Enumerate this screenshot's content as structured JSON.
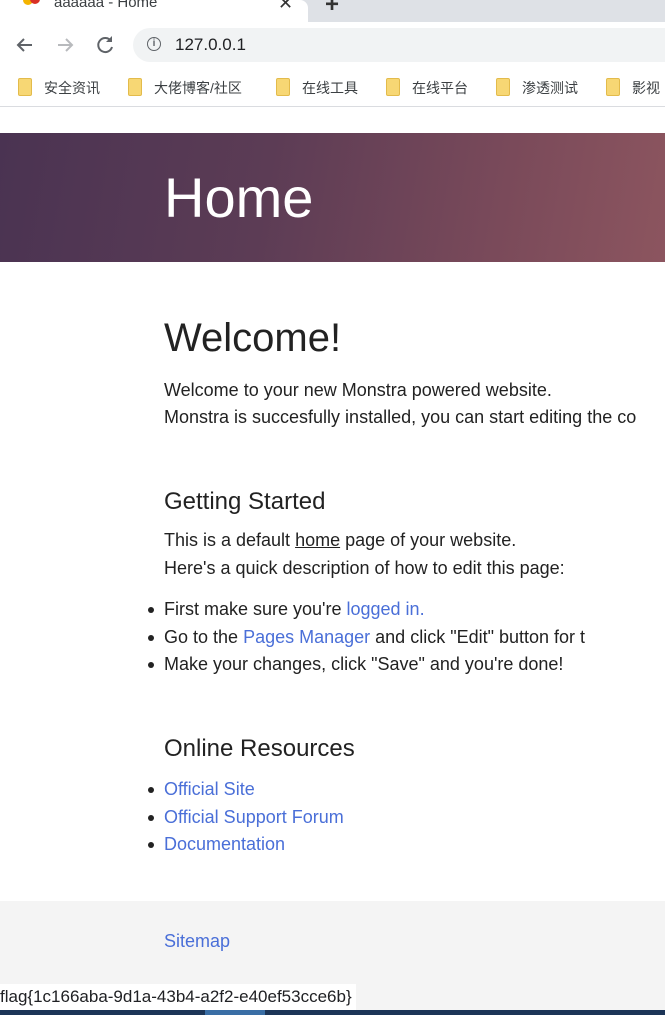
{
  "browser": {
    "tab_title": "aaaaaa - Home",
    "url": "127.0.0.1",
    "bookmarks": [
      "安全资讯",
      "大佬博客/社区",
      "在线工具",
      "在线平台",
      "渗透测试",
      "影视"
    ],
    "status_text": "flag{1c166aba-9d1a-43b4-a2f2-e40ef53cce6b}"
  },
  "page": {
    "hero_title": "Home",
    "welcome_heading": "Welcome!",
    "welcome_line1": "Welcome to your new Monstra powered website.",
    "welcome_line2": "Monstra is succesfully installed, you can start editing the co",
    "getting_started": {
      "heading": "Getting Started",
      "line1_pre": "This is a default ",
      "line1_link": "home",
      "line1_post": " page of your website.",
      "line2": "Here's a quick description of how to edit this page:",
      "item1_pre": "First make sure you're ",
      "item1_link": "logged in.",
      "item2_pre": "Go to the ",
      "item2_link": "Pages Manager",
      "item2_post": " and click \"Edit\" button for t",
      "item3": "Make your changes, click \"Save\" and you're done!"
    },
    "resources": {
      "heading": "Online Resources",
      "links": [
        "Official Site",
        "Official Support Forum",
        "Documentation"
      ]
    },
    "footer": {
      "sitemap": "Sitemap"
    }
  },
  "colors": {
    "link": "#4a6fd8",
    "hero_start": "#4a3352",
    "hero_end": "#8c555f"
  }
}
